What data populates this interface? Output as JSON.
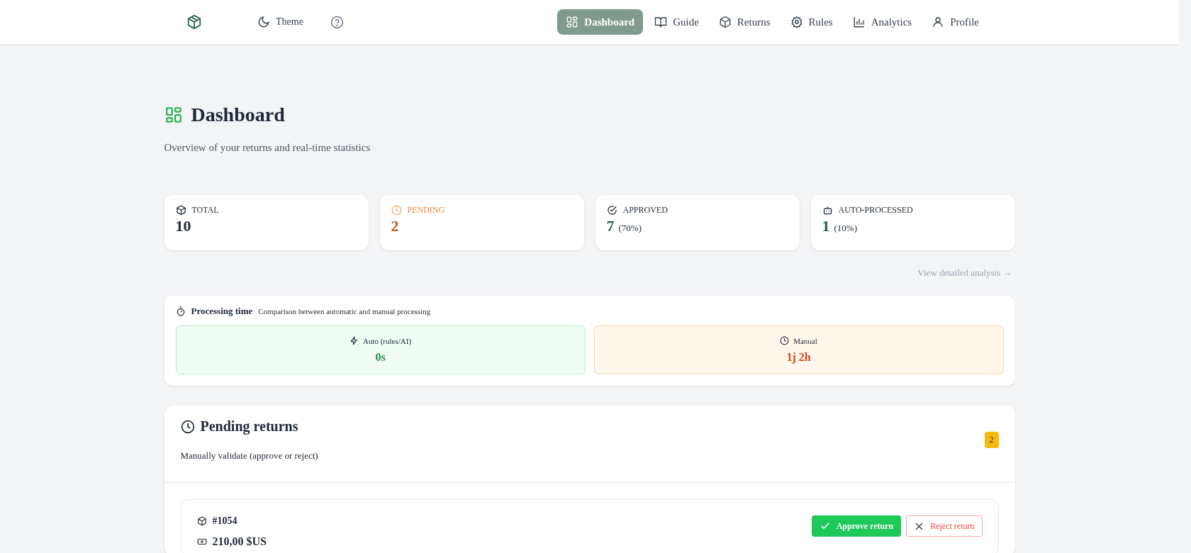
{
  "header": {
    "theme_label": "Theme",
    "nav": [
      {
        "label": "Dashboard",
        "selected": true
      },
      {
        "label": "Guide",
        "selected": false
      },
      {
        "label": "Returns",
        "selected": false
      },
      {
        "label": "Rules",
        "selected": false
      },
      {
        "label": "Analytics",
        "selected": false
      },
      {
        "label": "Profile",
        "selected": false
      }
    ]
  },
  "page": {
    "title": "Dashboard",
    "subtitle": "Overview of your returns and real-time statistics"
  },
  "stats": [
    {
      "kind": "total",
      "label": "TOTAL",
      "value": "10"
    },
    {
      "kind": "pending",
      "label": "PENDING",
      "value": "2"
    },
    {
      "kind": "approved",
      "label": "APPROVED",
      "value": "7",
      "percent": "(70%)"
    },
    {
      "kind": "auto",
      "label": "AUTO-PROCESSED",
      "value": "1",
      "percent": "(10%)"
    }
  ],
  "analysis_link": "View detailed analysis →",
  "processing": {
    "title": "Processing time",
    "subtitle": "Comparison between automatic and manual processing",
    "items": [
      {
        "kind": "auto",
        "label": "Auto (rules/AI)",
        "value": "0s"
      },
      {
        "kind": "manual",
        "label": "Manual",
        "value": "1j 2h"
      }
    ]
  },
  "pending": {
    "title": "Pending returns",
    "subtitle": "Manually validate (approve or reject)",
    "count": "2",
    "returns": [
      {
        "number": "#1054",
        "amount": "210,00 $US",
        "approve_label": "Approve return",
        "reject_label": "Reject return"
      }
    ]
  }
}
